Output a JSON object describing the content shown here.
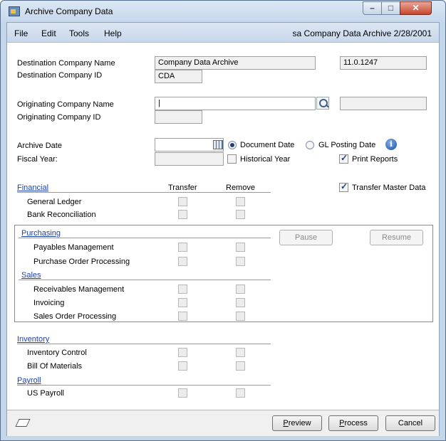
{
  "window": {
    "title": "Archive Company Data"
  },
  "menu": {
    "items": [
      "File",
      "Edit",
      "Tools",
      "Help"
    ],
    "status": "sa  Company Data Archive  2/28/2001"
  },
  "form": {
    "dest_company_name_label": "Destination Company Name",
    "dest_company_name_value": "Company Data Archive",
    "version_value": "11.0.1247",
    "dest_company_id_label": "Destination Company ID",
    "dest_company_id_value": "CDA",
    "orig_company_name_label": "Originating Company Name",
    "orig_company_name_value": "|",
    "orig_company_id_label": "Originating Company ID",
    "archive_date_label": "Archive Date",
    "fiscal_year_label": "Fiscal Year:",
    "document_date_label": "Document Date",
    "gl_posting_date_label": "GL Posting Date",
    "historical_year_label": "Historical Year",
    "print_reports_label": "Print Reports",
    "transfer_master_label": "Transfer Master Data"
  },
  "columns": {
    "transfer": "Transfer",
    "remove": "Remove"
  },
  "groups": {
    "financial": {
      "title": "Financial",
      "items": [
        "General Ledger",
        "Bank Reconciliation"
      ]
    },
    "purchasing": {
      "title": "Purchasing",
      "items": [
        "Payables Management",
        "Purchase Order Processing"
      ]
    },
    "sales": {
      "title": "Sales",
      "items": [
        "Receivables Management",
        "Invoicing",
        "Sales Order Processing"
      ]
    },
    "inventory": {
      "title": "Inventory",
      "items": [
        "Inventory Control",
        "Bill Of Materials"
      ]
    },
    "payroll": {
      "title": "Payroll",
      "items": [
        "US Payroll"
      ]
    }
  },
  "buttons": {
    "pause": "Pause",
    "resume": "Resume",
    "preview_u": "P",
    "preview_rest": "review",
    "process_u": "P",
    "process_rest": "rocess",
    "cancel": "Cancel"
  },
  "icons": {
    "app": "archive-app-icon",
    "lookup": "magnifier-icon",
    "calendar": "calendar-icon",
    "info": "info-icon",
    "note": "note-icon"
  }
}
